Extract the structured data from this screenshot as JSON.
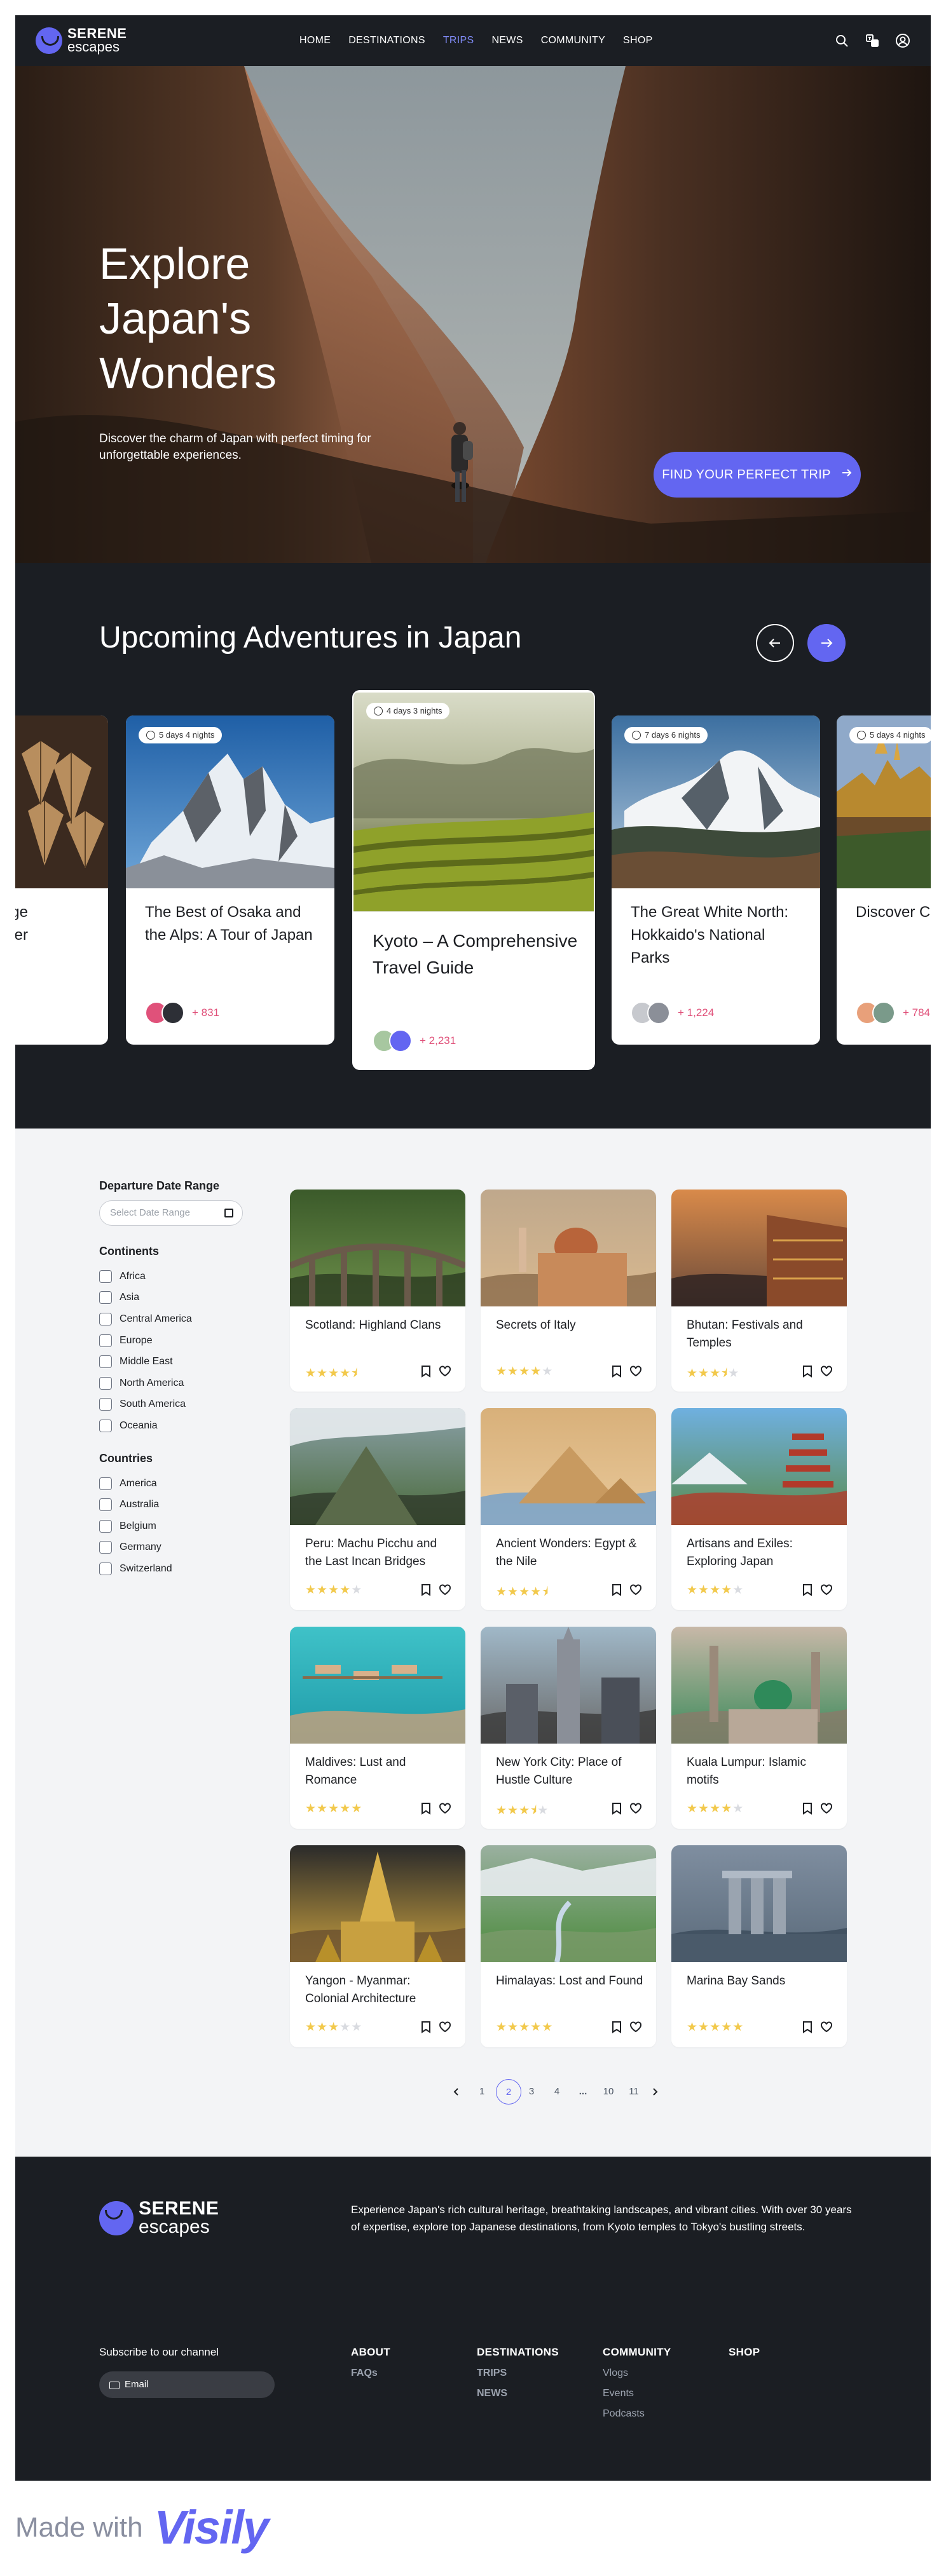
{
  "brand": {
    "line1": "SERENE",
    "line2": "escapes"
  },
  "nav": {
    "items": [
      {
        "label": "HOME",
        "active": false
      },
      {
        "label": "DESTINATIONS",
        "active": false
      },
      {
        "label": "TRIPS",
        "active": true
      },
      {
        "label": "NEWS",
        "active": false
      },
      {
        "label": "COMMUNITY",
        "active": false
      },
      {
        "label": "SHOP",
        "active": false
      }
    ],
    "icons": [
      "search-icon",
      "translate-icon",
      "user-icon"
    ]
  },
  "hero": {
    "title": "Explore Japan's Wonders",
    "subtitle": "Discover the charm of Japan with perfect timing for unforgettable experiences.",
    "cta_label": "FIND YOUR PERFECT TRIP"
  },
  "adventures": {
    "title": "Upcoming Adventures in Japan",
    "cards": [
      {
        "duration": "",
        "title": "ue Lounge eather",
        "count": ""
      },
      {
        "duration": "5 days 4 nights",
        "title": "The Best of Osaka and the Alps: A Tour of Japan",
        "count": "+ 831"
      },
      {
        "duration": "4 days 3 nights",
        "title": "Kyoto – A Comprehensive Travel Guide",
        "count": "+ 2,231"
      },
      {
        "duration": "7 days 6 nights",
        "title": "The Great White North: Hokkaido's National Parks",
        "count": "+ 1,224"
      },
      {
        "duration": "5 days 4 nights",
        "title": "Discover C Tropical Pa",
        "count": "+ 784"
      }
    ]
  },
  "filters": {
    "date_heading": "Departure Date Range",
    "date_placeholder": "Select Date Range",
    "continents_heading": "Continents",
    "continents": [
      "Africa",
      "Asia",
      "Central America",
      "Europe",
      "Middle East",
      "North America",
      "South America",
      "Oceania"
    ],
    "countries_heading": "Countries",
    "countries": [
      "America",
      "Australia",
      "Belgium",
      "Germany",
      "Switzerland"
    ]
  },
  "trips": [
    {
      "title": "Scotland: Highland Clans",
      "rating": 4.5
    },
    {
      "title": "Secrets of Italy",
      "rating": 4
    },
    {
      "title": "Bhutan: Festivals and Temples",
      "rating": 3.5
    },
    {
      "title": "Peru: Machu Picchu and the Last Incan Bridges",
      "rating": 4
    },
    {
      "title": "Ancient Wonders: Egypt & the Nile",
      "rating": 4.5
    },
    {
      "title": "Artisans and Exiles: Exploring Japan",
      "rating": 4
    },
    {
      "title": "Maldives: Lust and Romance",
      "rating": 5
    },
    {
      "title": "New York City: Place of Hustle Culture",
      "rating": 3.5
    },
    {
      "title": "Kuala Lumpur: Islamic motifs",
      "rating": 4
    },
    {
      "title": "Yangon - Myanmar: Colonial Architecture",
      "rating": 3
    },
    {
      "title": "Himalayas: Lost and Found",
      "rating": 5
    },
    {
      "title": "Marina Bay Sands",
      "rating": 5
    }
  ],
  "pagination": {
    "pages": [
      "1",
      "2",
      "3",
      "4",
      "...",
      "10",
      "11"
    ],
    "current": "2"
  },
  "footer": {
    "about": "Experience Japan's rich cultural heritage, breathtaking landscapes, and vibrant cities. With over 30 years of expertise, explore top Japanese destinations, from Kyoto temples to Tokyo's bustling streets.",
    "subscribe_heading": "Subscribe to our channel",
    "email_placeholder": "Email",
    "columns": [
      {
        "heading": "ABOUT",
        "links": [
          "FAQs"
        ]
      },
      {
        "heading": "DESTINATIONS",
        "links": [
          "TRIPS",
          "NEWS"
        ]
      },
      {
        "heading": "COMMUNITY",
        "links": [
          "Vlogs",
          "Events",
          "Podcasts"
        ]
      },
      {
        "heading": "SHOP",
        "links": []
      }
    ]
  },
  "made_with": {
    "prefix": "Made with",
    "brand": "Visily"
  },
  "colors": {
    "accent": "#6366f1",
    "dark": "#1b1e23",
    "star": "#f2c94c",
    "count": "#e0517a"
  }
}
